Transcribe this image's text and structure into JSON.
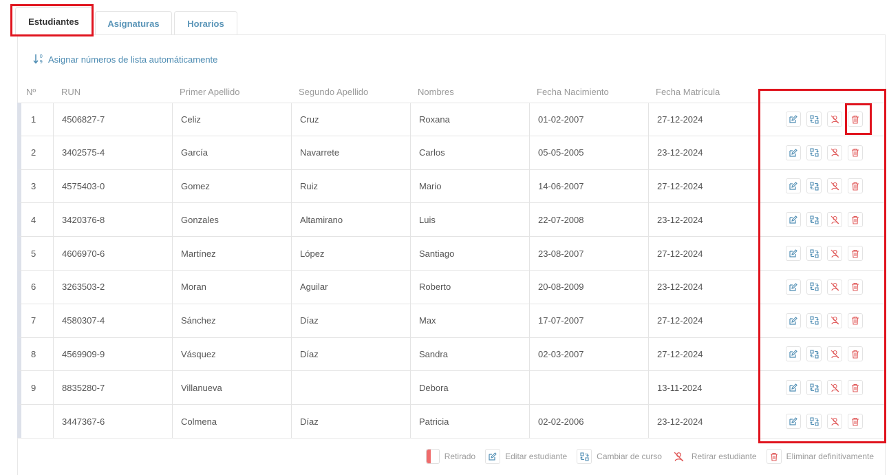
{
  "tabs": [
    {
      "label": "Estudiantes",
      "active": true
    },
    {
      "label": "Asignaturas",
      "active": false
    },
    {
      "label": "Horarios",
      "active": false
    }
  ],
  "auto_assign": {
    "label": "Asignar números de lista automáticamente",
    "icon": "sort-numeric-icon"
  },
  "columns": [
    "Nº",
    "RUN",
    "Primer Apellido",
    "Segundo Apellido",
    "Nombres",
    "Fecha Nacimiento",
    "Fecha Matrícula"
  ],
  "rows": [
    {
      "num": "1",
      "run": "4506827-7",
      "apellido1": "Celiz",
      "apellido2": "Cruz",
      "nombres": "Roxana",
      "nacimiento": "01-02-2007",
      "matricula": "27-12-2024"
    },
    {
      "num": "2",
      "run": "3402575-4",
      "apellido1": "García",
      "apellido2": "Navarrete",
      "nombres": "Carlos",
      "nacimiento": "05-05-2005",
      "matricula": "23-12-2024"
    },
    {
      "num": "3",
      "run": "4575403-0",
      "apellido1": "Gomez",
      "apellido2": "Ruiz",
      "nombres": "Mario",
      "nacimiento": "14-06-2007",
      "matricula": "27-12-2024"
    },
    {
      "num": "4",
      "run": "3420376-8",
      "apellido1": "Gonzales",
      "apellido2": "Altamirano",
      "nombres": "Luis",
      "nacimiento": "22-07-2008",
      "matricula": "23-12-2024"
    },
    {
      "num": "5",
      "run": "4606970-6",
      "apellido1": "Martínez",
      "apellido2": "López",
      "nombres": "Santiago",
      "nacimiento": "23-08-2007",
      "matricula": "27-12-2024"
    },
    {
      "num": "6",
      "run": "3263503-2",
      "apellido1": "Moran",
      "apellido2": "Aguilar",
      "nombres": "Roberto",
      "nacimiento": "20-08-2009",
      "matricula": "23-12-2024"
    },
    {
      "num": "7",
      "run": "4580307-4",
      "apellido1": "Sánchez",
      "apellido2": "Díaz",
      "nombres": "Max",
      "nacimiento": "17-07-2007",
      "matricula": "27-12-2024"
    },
    {
      "num": "8",
      "run": "4569909-9",
      "apellido1": "Vásquez",
      "apellido2": "Díaz",
      "nombres": "Sandra",
      "nacimiento": "02-03-2007",
      "matricula": "27-12-2024"
    },
    {
      "num": "9",
      "run": "8835280-7",
      "apellido1": "Villanueva",
      "apellido2": "",
      "nombres": "Debora",
      "nacimiento": "",
      "matricula": "13-11-2024"
    },
    {
      "num": "",
      "run": "3447367-6",
      "apellido1": "Colmena",
      "apellido2": "Díaz",
      "nombres": "Patricia",
      "nacimiento": "02-02-2006",
      "matricula": "23-12-2024"
    }
  ],
  "legend": {
    "retirado": "Retirado",
    "editar": "Editar estudiante",
    "cambiar": "Cambiar de curso",
    "retirar": "Retirar estudiante",
    "eliminar": "Eliminar definitivamente"
  },
  "colors": {
    "accent": "#4f8db3",
    "danger": "#e05a5a",
    "highlight": "#e0141e",
    "row_marker": "#dde1ea",
    "retired_marker": "#ef6b6b"
  }
}
